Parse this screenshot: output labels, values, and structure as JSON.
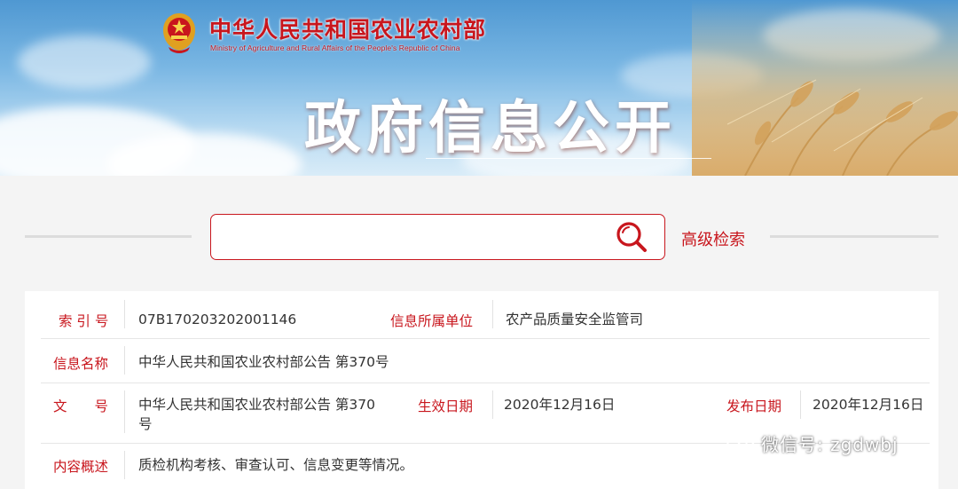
{
  "header": {
    "ministry_name_cn": "中华人民共和国农业农村部",
    "ministry_name_en": "Ministry of Agriculture and Rural Affairs of the People's Republic of China",
    "banner_title": "政府信息公开"
  },
  "search": {
    "placeholder": "",
    "value": "",
    "advanced_label": "高级检索"
  },
  "info": {
    "index_label": "索 引 号",
    "index_value": "07B170203202001146",
    "unit_label": "信息所属单位",
    "unit_value": "农产品质量安全监管司",
    "name_label": "信息名称",
    "name_value": "中华人民共和国农业农村部公告 第370号",
    "doc_label": "文　　号",
    "doc_value_line1": "中华人民共和国农业农村部公告 第370",
    "doc_value_line2": "号",
    "effective_label": "生效日期",
    "effective_value": "2020年12月16日",
    "publish_label": "发布日期",
    "publish_value": "2020年12月16日",
    "summary_label": "内容概述",
    "summary_value": "质检机构考核、审查认可、信息变更等情况。"
  },
  "watermark": {
    "text": "微信号: zgdwbj"
  },
  "colors": {
    "accent": "#c8161d",
    "text": "#333333",
    "page_bg": "#f4f4f4"
  }
}
